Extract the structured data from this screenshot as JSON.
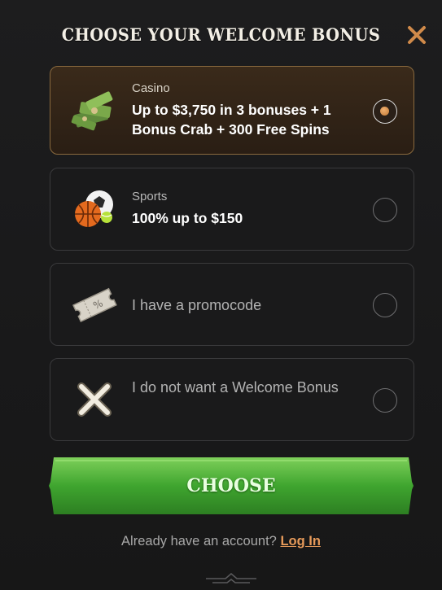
{
  "modal": {
    "title": "CHOOSE YOUR WELCOME BONUS",
    "close_icon": "close-icon"
  },
  "options": [
    {
      "label": "Casino",
      "description": "Up to $3,750 in 3 bonuses + 1 Bonus Crab + 300 Free Spins",
      "icon": "money-stack-icon",
      "selected": true
    },
    {
      "label": "Sports",
      "description": "100% up to $150",
      "icon": "sports-balls-icon",
      "selected": false
    },
    {
      "label": "I have a promocode",
      "icon": "ticket-icon",
      "selected": false
    },
    {
      "label": "I do not want a Welcome Bonus",
      "icon": "cross-icon",
      "selected": false
    }
  ],
  "choose_button": {
    "label": "CHOOSE"
  },
  "footer": {
    "prompt": "Already have an account?",
    "login_label": "Log In"
  },
  "colors": {
    "background": "#1b1b1c",
    "selected_border": "#8a6a3e",
    "button_green": "#3fa52f",
    "link_orange": "#e69a5a"
  }
}
